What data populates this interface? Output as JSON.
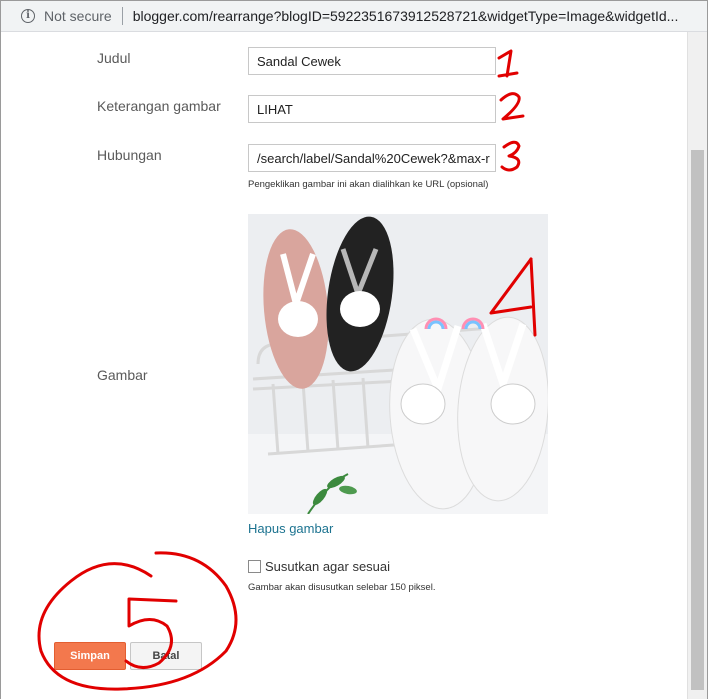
{
  "browser": {
    "security_text": "Not secure",
    "url": "blogger.com/rearrange?blogID=5922351673912528721&widgetType=Image&widgetId..."
  },
  "form": {
    "title_label": "Judul",
    "title_value": "Sandal Cewek",
    "caption_label": "Keterangan gambar",
    "caption_value": "LIHAT",
    "link_label": "Hubungan",
    "link_value": "/search/label/Sandal%20Cewek?&max-r",
    "link_hint": "Pengeklikan gambar ini akan dialihkan ke URL (opsional)",
    "image_label": "Gambar",
    "remove_image_link": "Hapus gambar",
    "shrink_checkbox_label": "Susutkan agar sesuai",
    "shrink_checked": false,
    "shrink_hint": "Gambar akan disusutkan selebar 150 piksel.",
    "save_button": "Simpan",
    "cancel_button": "Batal"
  },
  "annotations": {
    "marks": [
      "1",
      "2",
      "3",
      "4",
      "5"
    ],
    "color": "#e10000"
  },
  "colors": {
    "primary_button": "#f3784d",
    "link": "#1c7390"
  }
}
